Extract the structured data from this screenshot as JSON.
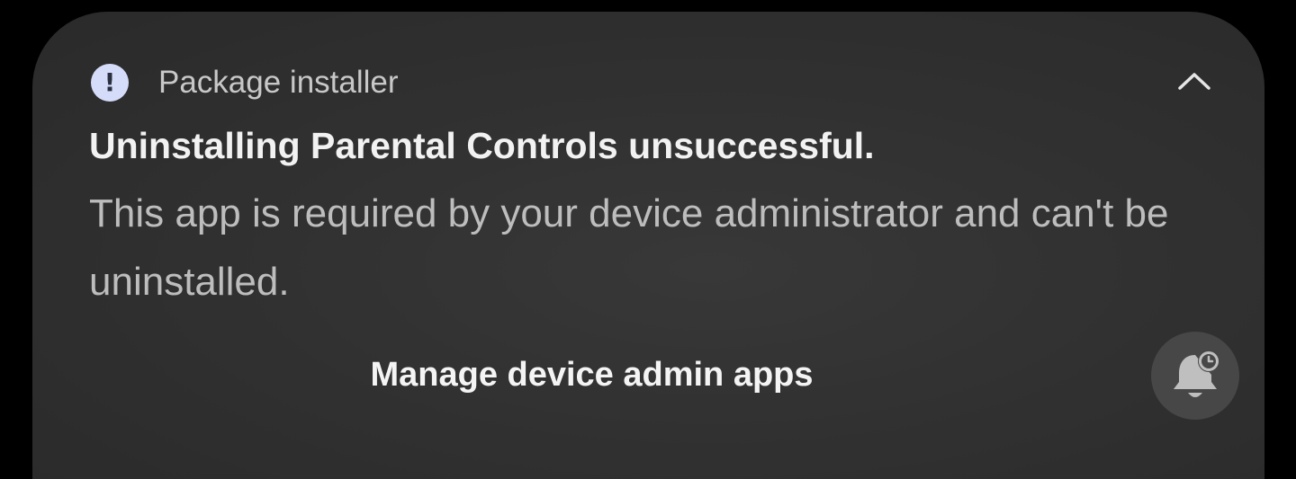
{
  "notification": {
    "app_name": "Package installer",
    "app_icon": "exclamation-info-icon",
    "title": "Uninstalling Parental Controls unsuccessful.",
    "body": "This app is required by your device administrator and can't be uninstalled.",
    "action_label": "Manage device admin apps",
    "collapse_icon": "chevron-up-icon",
    "snooze_icon": "bell-snooze-icon"
  },
  "colors": {
    "background": "#000000",
    "card": "#313131",
    "app_icon_bg": "#d4dcfa",
    "title_text": "#f2f2f2",
    "body_text": "#bdbdbd",
    "snooze_bg": "#474747"
  }
}
